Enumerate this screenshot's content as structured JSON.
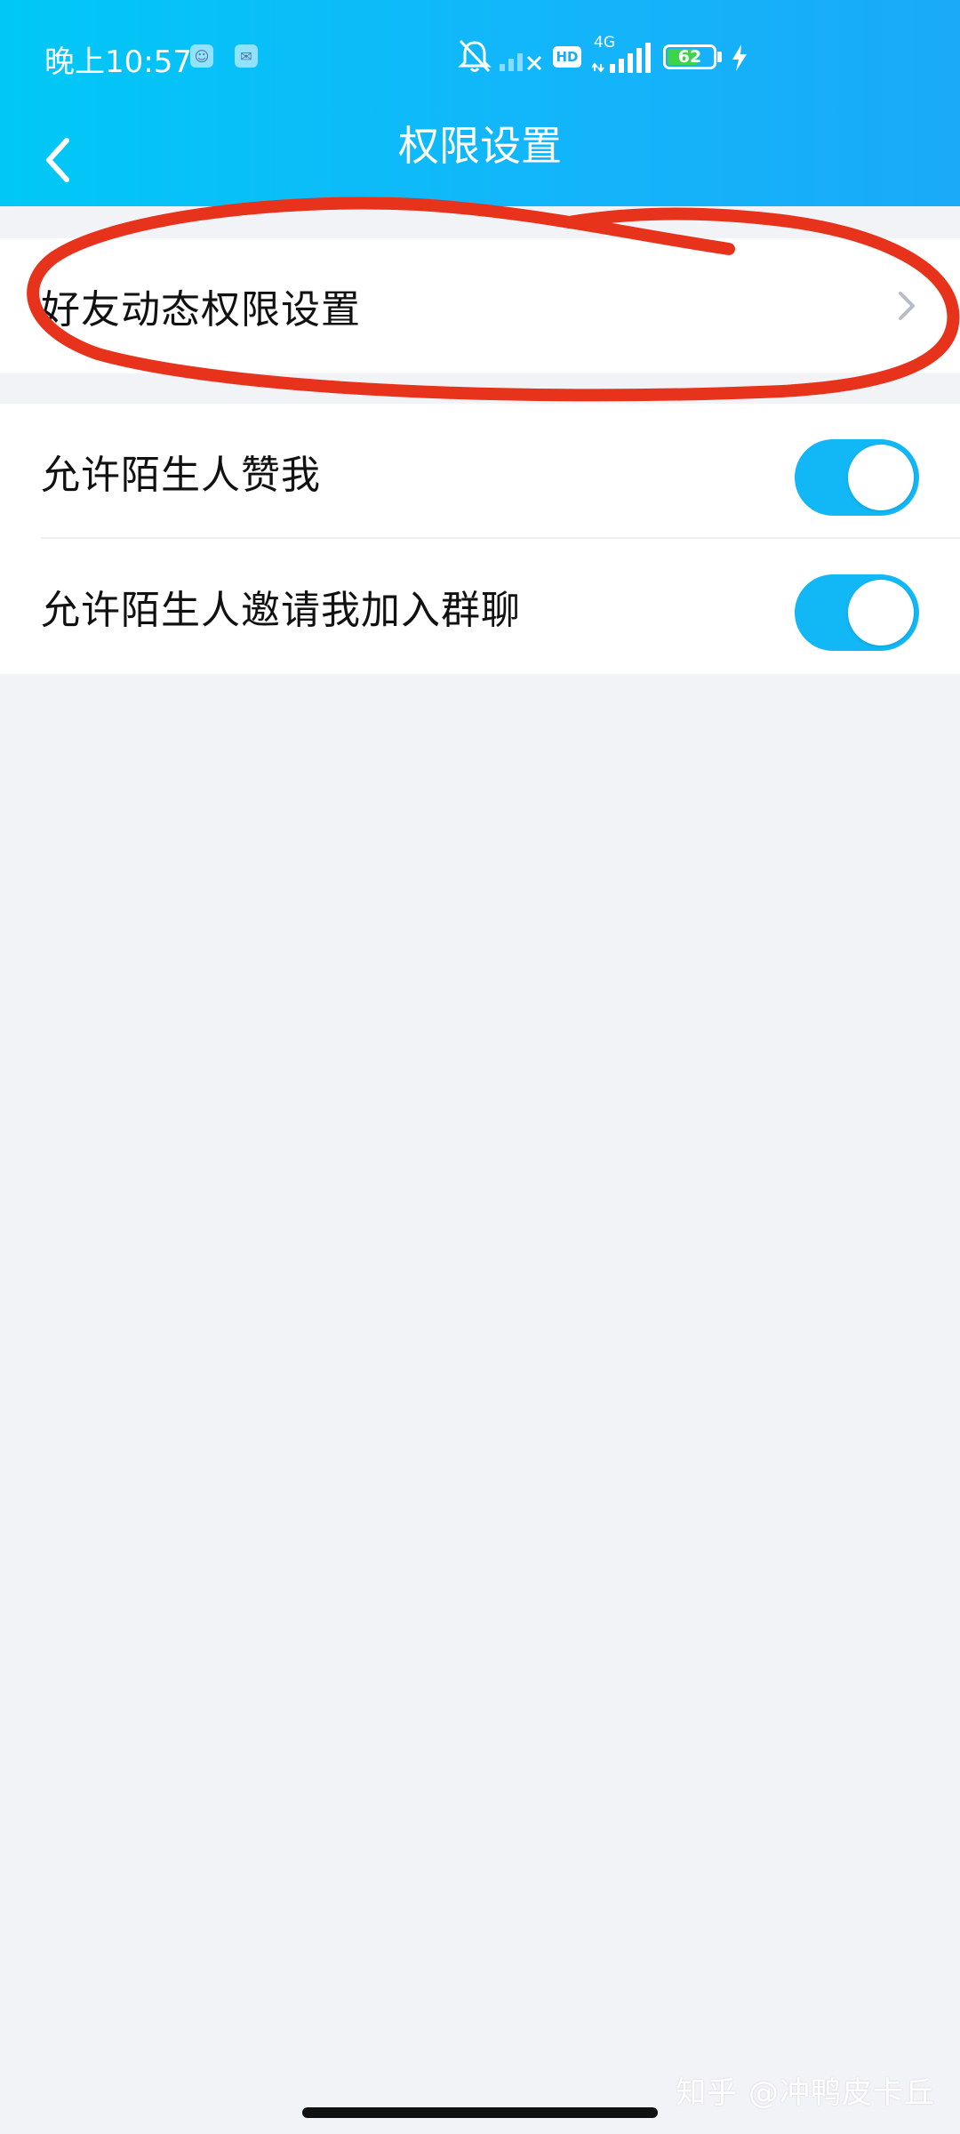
{
  "status_bar": {
    "time": "晚上10:57",
    "hd_label": "HD",
    "network_label": "4G",
    "battery_level": "62"
  },
  "nav": {
    "title": "权限设置",
    "back_icon": "chevron-left-icon"
  },
  "settings": {
    "group1": {
      "items": [
        {
          "label": "好友动态权限设置",
          "icon": "chevron-right-icon"
        }
      ]
    },
    "group2": {
      "items": [
        {
          "label": "允许陌生人赞我",
          "enabled": true
        },
        {
          "label": "允许陌生人邀请我加入群聊",
          "enabled": true
        }
      ]
    }
  },
  "watermark": "知乎 @冲鸭皮卡丘",
  "colors": {
    "header_gradient_start": "#00c8f6",
    "header_gradient_end": "#1aaaf8",
    "toggle_on": "#12b7f5",
    "annotation": "#e8331c",
    "page_bg": "#f2f3f7"
  }
}
